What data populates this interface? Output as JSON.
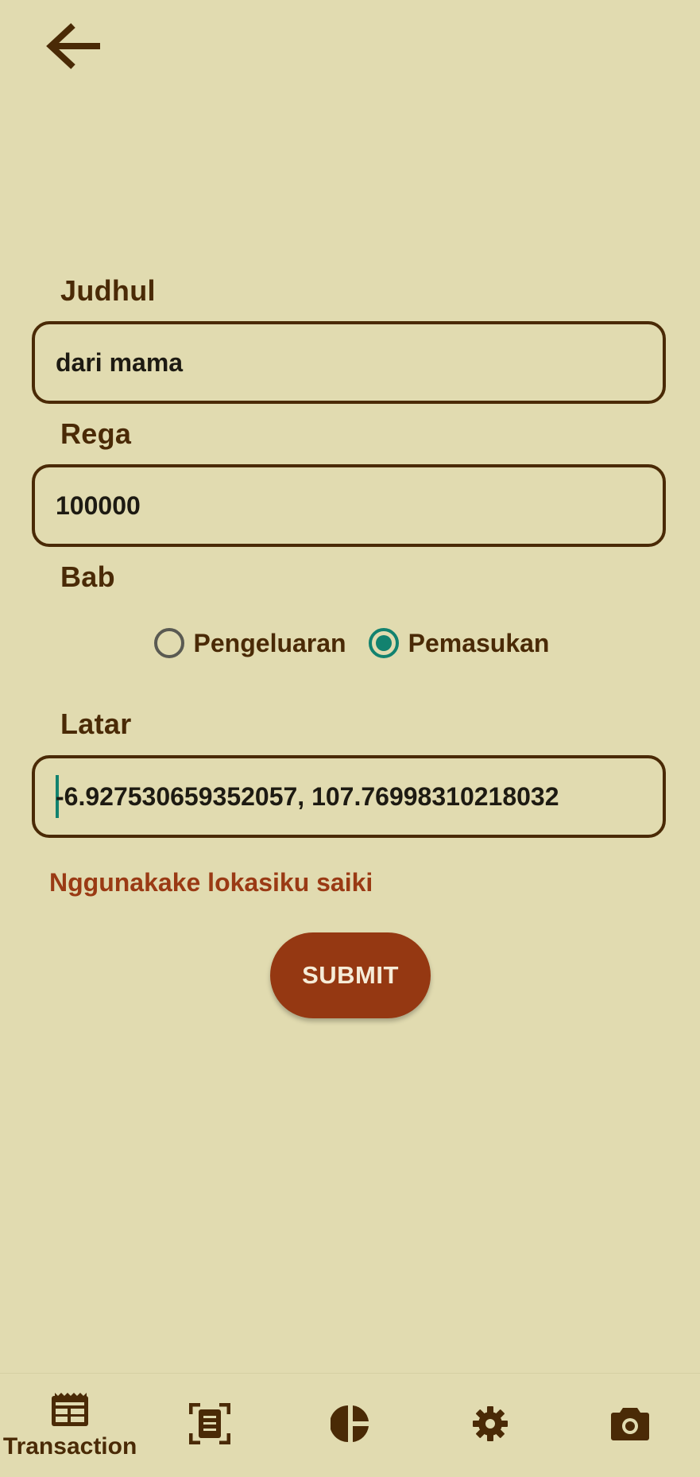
{
  "form": {
    "title_label": "Judhul",
    "title_value": "dari mama",
    "price_label": "Rega",
    "price_value": "100000",
    "category_label": "Bab",
    "category_options": [
      {
        "label": "Pengeluaran",
        "selected": false
      },
      {
        "label": "Pemasukan",
        "selected": true
      }
    ],
    "location_label": "Latar",
    "location_value": "-6.927530659352057, 107.76998310218032",
    "use_location_link": "Nggunakake lokasiku saiki",
    "submit_label": "SUBMIT"
  },
  "bottom_nav": {
    "items": [
      {
        "icon": "transaction-icon",
        "label": "Transaction",
        "active": true
      },
      {
        "icon": "receipt-scan-icon",
        "label": "",
        "active": false
      },
      {
        "icon": "pie-chart-icon",
        "label": "",
        "active": false
      },
      {
        "icon": "gear-icon",
        "label": "",
        "active": false
      },
      {
        "icon": "camera-icon",
        "label": "",
        "active": false
      }
    ]
  },
  "colors": {
    "background": "#e1dbb0",
    "primary_text": "#4a2a06",
    "accent": "#12826f",
    "button": "#953812",
    "link": "#9a3a14"
  }
}
